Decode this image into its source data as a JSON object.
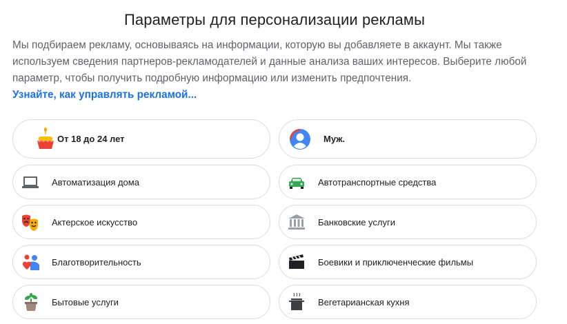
{
  "page": {
    "title": "Параметры для персонализации рекламы",
    "description": "Мы подбираем рекламу, основываясь на информации, которую вы добавляете в аккаунт. Мы также используем сведения партнеров-рекламодателей и данные анализа ваших интересов. Выберите любой параметр, чтобы получить подробную информацию или изменить предпочтения.",
    "learn_more_link": "Узнайте, как управлять рекламой..."
  },
  "factors": {
    "age": {
      "label": "От 18 до 24 лет",
      "icon": "birthday-cake-icon"
    },
    "gender": {
      "label": "Муж.",
      "icon": "person-avatar-icon"
    },
    "home_automation": {
      "label": "Автоматизация дома",
      "icon": "laptop-icon"
    },
    "vehicles": {
      "label": "Автотранспортные средства",
      "icon": "car-icon"
    },
    "acting": {
      "label": "Актерское искусство",
      "icon": "theater-masks-icon"
    },
    "banking": {
      "label": "Банковские услуги",
      "icon": "bank-icon"
    },
    "charity": {
      "label": "Благотворительность",
      "icon": "people-heart-icon"
    },
    "action_movies": {
      "label": "Боевики и приключенческие фильмы",
      "icon": "clapperboard-icon"
    },
    "household_services": {
      "label": "Бытовые услуги",
      "icon": "potted-plant-icon"
    },
    "vegetarian": {
      "label": "Вегетарианская кухня",
      "icon": "cooking-pot-icon"
    }
  },
  "colors": {
    "link": "#1a73e8",
    "border": "#dadce0",
    "text": "#202124",
    "muted": "#5f6368"
  }
}
